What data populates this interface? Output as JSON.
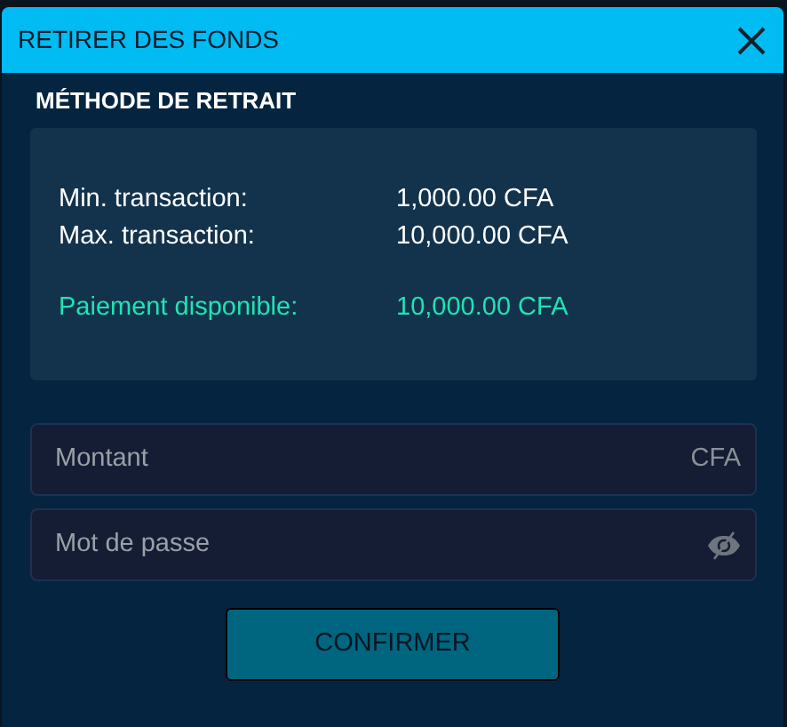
{
  "dialog": {
    "title": "RETIRER DES FONDS"
  },
  "section": {
    "title": "MÉTHODE DE RETRAIT"
  },
  "info_rows": [
    {
      "kind": "limit",
      "label": "Min. transaction:",
      "value": "1,000.00 CFA"
    },
    {
      "kind": "limit",
      "label": "Max. transaction:",
      "value": "10,000.00 CFA"
    },
    {
      "kind": "available",
      "label": "Paiement disponible:",
      "value": "10,000.00 CFA"
    }
  ],
  "amount_field": {
    "placeholder": "Montant",
    "suffix": "CFA"
  },
  "password_field": {
    "placeholder": "Mot de passe"
  },
  "confirm_button": "CONFIRMER"
}
